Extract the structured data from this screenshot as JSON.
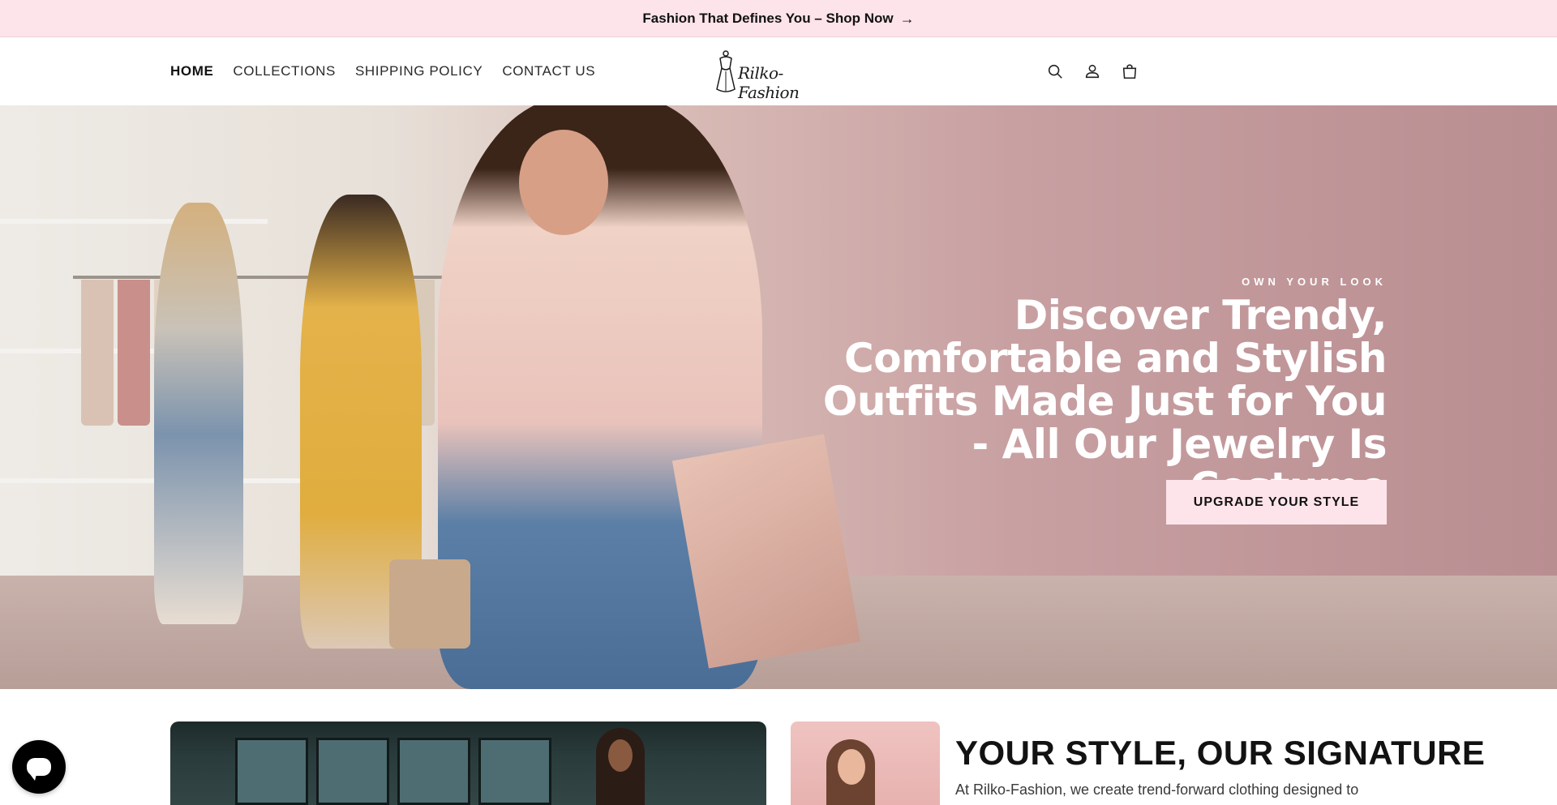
{
  "announcement": {
    "text": "Fashion That Defines You – Shop Now",
    "arrow": "→"
  },
  "nav": {
    "items": [
      {
        "label": "HOME",
        "active": true
      },
      {
        "label": "COLLECTIONS",
        "active": false
      },
      {
        "label": "SHIPPING POLICY",
        "active": false
      },
      {
        "label": "CONTACT US",
        "active": false
      }
    ]
  },
  "logo": {
    "text": "Rilko-Fashion"
  },
  "header_icons": [
    "search-icon",
    "account-icon",
    "cart-icon"
  ],
  "hero": {
    "eyebrow": "OWN YOUR LOOK",
    "title": "Discover Trendy, Comfortable and Stylish Outfits Made Just for You - All Our Jewelry Is Costume",
    "cta": "UPGRADE YOUR STYLE"
  },
  "section": {
    "title": "YOUR STYLE, OUR SIGNATURE",
    "body": "At Rilko-Fashion, we create trend-forward clothing designed to"
  },
  "colors": {
    "announcement_bg": "#fde4ea",
    "cta_bg": "#fde4ea",
    "chat_bg": "#000000"
  }
}
